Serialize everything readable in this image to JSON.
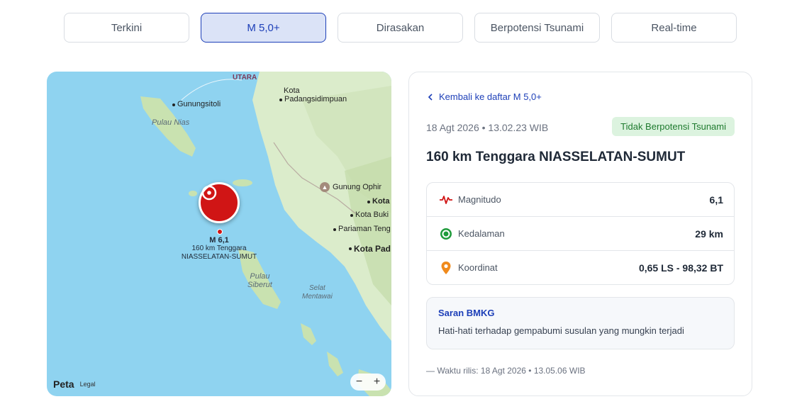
{
  "tabs": [
    {
      "label": "Terkini"
    },
    {
      "label": "M 5,0+"
    },
    {
      "label": "Dirasakan"
    },
    {
      "label": "Berpotensi Tsunami"
    },
    {
      "label": "Real-time"
    }
  ],
  "map": {
    "labels": {
      "utara": "UTARA",
      "gunungsitoli": "Gunungsitoli",
      "pulau_nias": "Pulau Nias",
      "kota_padang_line1": "Kota",
      "kota_padang_line2": "Padangsidimpuan",
      "gunung_ophir": "Gunung Ophir",
      "kota": "Kota",
      "kota_buki": "Kota Buki",
      "pariaman": "Pariaman Teng",
      "kota_pad": "Kota Pad",
      "pulau_siberut_line1": "Pulau",
      "pulau_siberut_line2": "Siberut",
      "selat_line1": "Selat",
      "selat_line2": "Mentawai"
    },
    "marker": {
      "magnitude": "M 6,1",
      "location_line1": "160 km Tenggara",
      "location_line2": "NIASSELATAN-SUMUT"
    },
    "attribution": {
      "brand": "Peta",
      "legal": "Legal"
    },
    "zoom": {
      "minus": "−",
      "plus": "+"
    }
  },
  "detail": {
    "back_label": "Kembali ke daftar M 5,0+",
    "datetime": "18 Agt 2026 • 13.02.23 WIB",
    "tsunami_badge": "Tidak Berpotensi Tsunami",
    "title": "160 km Tenggara NIASSELATAN-SUMUT",
    "rows": [
      {
        "label": "Magnitudo",
        "value": "6,1",
        "icon": "waveform-icon"
      },
      {
        "label": "Kedalaman",
        "value": "29 km",
        "icon": "target-icon"
      },
      {
        "label": "Koordinat",
        "value": "0,65 LS - 98,32 BT",
        "icon": "location-pin-icon"
      }
    ],
    "advice": {
      "heading": "Saran BMKG",
      "text": "Hati-hati terhadap gempabumi susulan yang mungkin terjadi"
    },
    "release": "— Waktu rilis: 18 Agt 2026 • 13.05.06 WIB"
  },
  "colors": {
    "accent": "#1d3fb8",
    "marker": "#d01515",
    "badge_bg": "#dcf3df",
    "badge_text": "#1e7a2e",
    "sea": "#8fd3f0",
    "land": "#dbeccb"
  }
}
